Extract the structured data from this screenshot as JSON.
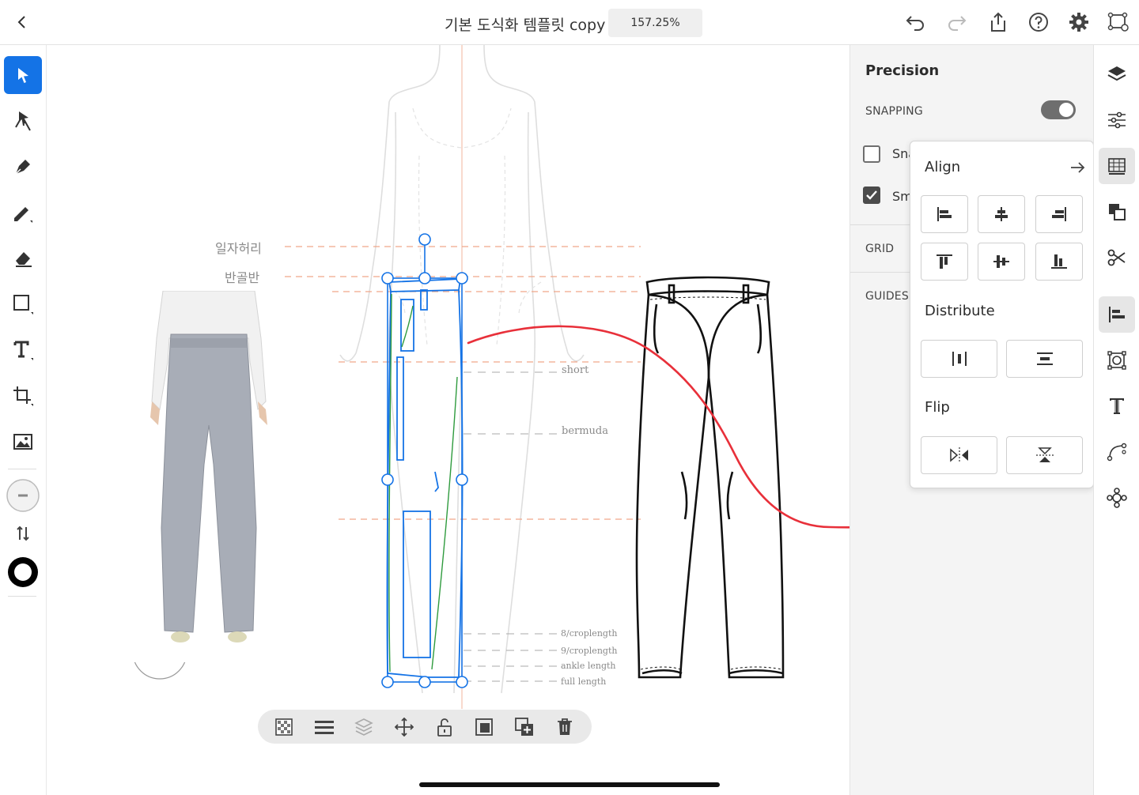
{
  "header": {
    "title": "기본 도식화 템플릿 copy",
    "zoom": "157.25%",
    "icons": [
      "back-icon",
      "undo-icon",
      "redo-icon",
      "share-icon",
      "help-icon",
      "settings-icon",
      "device-icon"
    ]
  },
  "tools": [
    "selection-tool",
    "direct-selection-tool",
    "pen-tool",
    "pencil-tool",
    "eraser-tool",
    "shape-tool",
    "text-tool",
    "transform-tool",
    "image-tool",
    "fill-swatch",
    "swap-icon",
    "stroke-swatch"
  ],
  "canvas": {
    "guide_labels": [
      "일자허리",
      "반골반"
    ],
    "length_labels": {
      "short": "short",
      "bermuda": "bermuda",
      "crop8": "8/croplength",
      "crop9": "9/croplength",
      "ankle": "ankle length",
      "full": "full length"
    }
  },
  "precision": {
    "title": "Precision",
    "snapping_label": "SNAPPING",
    "snapping_on": true,
    "snap_item_label": "Sna",
    "smart_item_label": "Sm",
    "grid_label": "GRID",
    "guides_label": "GUIDES"
  },
  "align_popover": {
    "align_title": "Align",
    "distribute_title": "Distribute",
    "flip_title": "Flip",
    "align_buttons": [
      "align-left",
      "align-horizontal-center",
      "align-right",
      "align-top",
      "align-vertical-center",
      "align-bottom"
    ],
    "distribute_buttons": [
      "distribute-horizontal",
      "distribute-vertical"
    ],
    "flip_buttons": [
      "flip-horizontal",
      "flip-vertical"
    ]
  },
  "rail": [
    "layers-icon",
    "properties-icon",
    "precision-icon",
    "combine-icon",
    "cut-icon",
    "align-icon",
    "transform-icon",
    "type-icon",
    "path-icon",
    "patterns-icon"
  ],
  "bottom_toolbar": [
    "transparency-icon",
    "menu-icon",
    "arrange-icon",
    "move-icon",
    "lock-icon",
    "mask-icon",
    "duplicate-icon",
    "delete-icon"
  ],
  "colors": {
    "accent": "#1473e6",
    "annotation": "#e8303a",
    "guide": "#f0a78a"
  }
}
